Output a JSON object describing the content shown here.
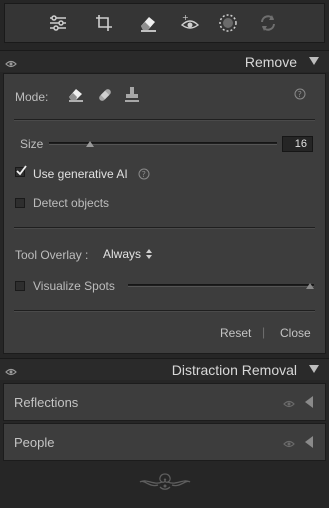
{
  "toolbar": {
    "tools": [
      {
        "icon": "sliders-icon"
      },
      {
        "icon": "crop-icon"
      },
      {
        "icon": "eraser-icon"
      },
      {
        "icon": "add-eye-icon"
      },
      {
        "icon": "circle-select-icon"
      },
      {
        "icon": "rotate-icon"
      }
    ]
  },
  "remove_panel": {
    "title": "Remove",
    "mode_label": "Mode:",
    "size_label": "Size",
    "size_value": "16",
    "size_fraction": 0.17,
    "generative_ai_label": "Use generative AI",
    "generative_ai_checked": true,
    "detect_objects_label": "Detect objects",
    "detect_objects_checked": false,
    "tool_overlay_label": "Tool Overlay :",
    "tool_overlay_value": "Always",
    "visualize_spots_label": "Visualize Spots",
    "visualize_spots_checked": false,
    "visualize_fraction": 1.0,
    "reset_label": "Reset",
    "close_label": "Close",
    "separator": "|"
  },
  "distraction_panel": {
    "title": "Distraction Removal",
    "items": [
      {
        "label": "Reflections"
      },
      {
        "label": "People"
      }
    ]
  }
}
